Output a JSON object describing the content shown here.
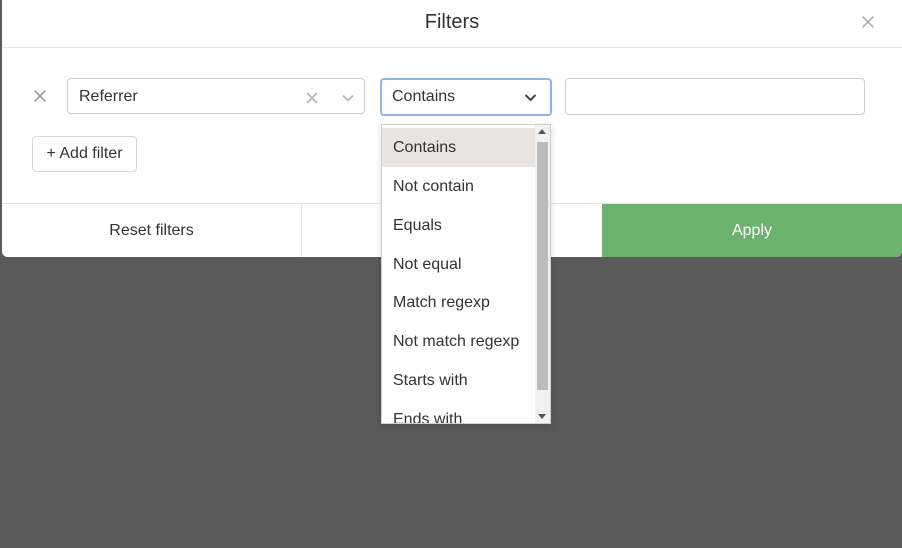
{
  "modal": {
    "title": "Filters"
  },
  "filter_row": {
    "field_value": "Referrer",
    "operator_value": "Contains",
    "value_input": ""
  },
  "add_filter_label": "+ Add filter",
  "footer": {
    "reset_label": "Reset filters",
    "apply_label": "Apply"
  },
  "dropdown": {
    "selected": "Contains",
    "options": [
      "Contains",
      "Not contain",
      "Equals",
      "Not equal",
      "Match regexp",
      "Not match regexp",
      "Starts with",
      "Ends with"
    ]
  },
  "colors": {
    "apply_bg": "#6cb26e",
    "focus_border": "#8eb4e8",
    "overlay": "#5a5a5a",
    "selected_option_bg": "#e8e4e2"
  },
  "icons": {
    "close": "close-icon",
    "remove_filter": "remove-filter-icon",
    "clear": "clear-icon",
    "chevron": "chevron-down-icon"
  }
}
